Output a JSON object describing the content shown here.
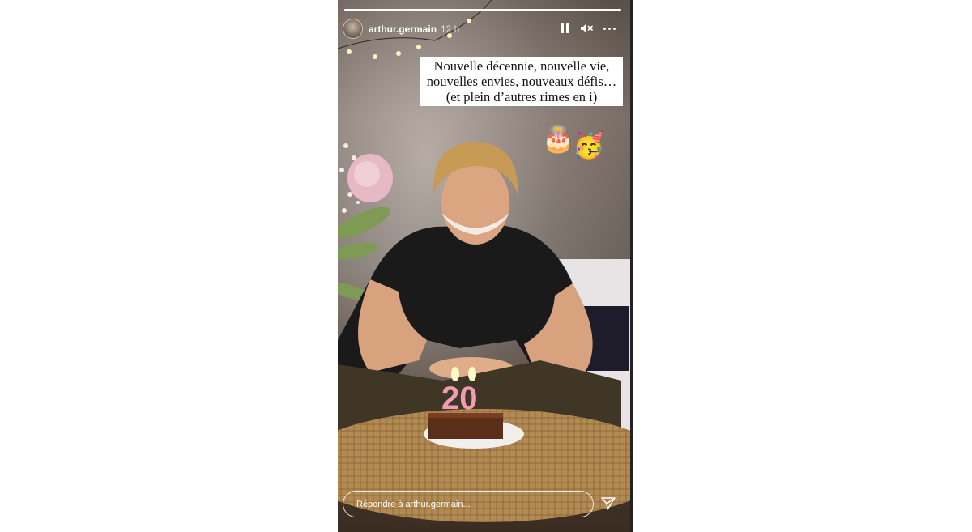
{
  "story": {
    "username": "arthur.germain",
    "timestamp": "12 h",
    "progress": 1.0,
    "text_overlay": {
      "line1": "Nouvelle décennie, nouvelle vie,",
      "line2": "nouvelles envies, nouveaux défis…",
      "line3": "(et plein d’autres rimes en i)"
    },
    "stickers": {
      "cake": "🎂",
      "party": "🥳"
    },
    "candles": "20"
  },
  "controls": {
    "pause_icon": "pause-icon",
    "mute_icon": "speaker-muted-icon",
    "more_icon": "more-horizontal-icon"
  },
  "reply": {
    "placeholder": "Répondre à arthur.germain...",
    "send_icon": "paper-plane-icon"
  }
}
